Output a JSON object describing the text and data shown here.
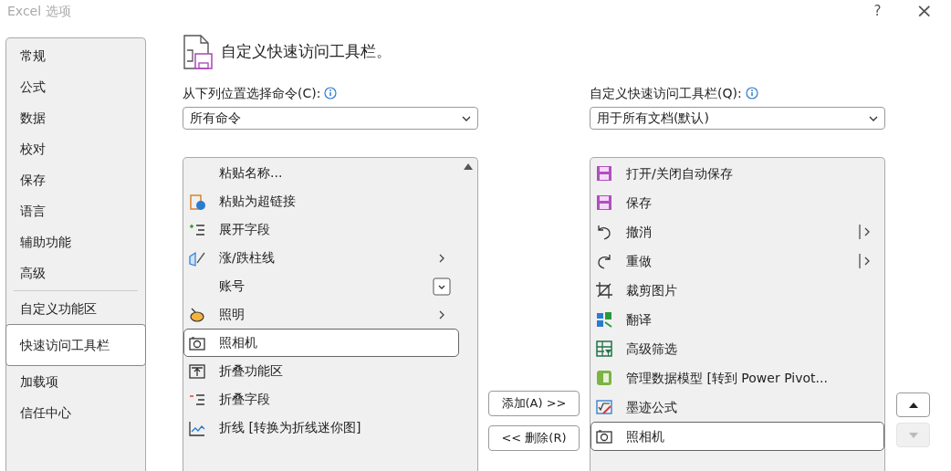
{
  "window": {
    "title": "Excel 选项",
    "help": "?",
    "close": "×"
  },
  "sidebar": {
    "items": [
      {
        "label": "常规",
        "selected": false
      },
      {
        "label": "公式",
        "selected": false
      },
      {
        "label": "数据",
        "selected": false
      },
      {
        "label": "校对",
        "selected": false
      },
      {
        "label": "保存",
        "selected": false
      },
      {
        "label": "语言",
        "selected": false
      },
      {
        "label": "辅助功能",
        "selected": false
      },
      {
        "label": "高级",
        "selected": false,
        "divider_after": true
      },
      {
        "label": "自定义功能区",
        "selected": false
      },
      {
        "label": "快速访问工具栏",
        "selected": true
      },
      {
        "label": "加载项",
        "selected": false
      },
      {
        "label": "信任中心",
        "selected": false
      }
    ]
  },
  "heading": "自定义快速访问工具栏。",
  "commands_from": {
    "label": "从下列位置选择命令(C):",
    "value": "所有命令"
  },
  "customize_for": {
    "label": "自定义快速访问工具栏(Q):",
    "value": "用于所有文档(默认)"
  },
  "available_commands": [
    {
      "label": "粘贴名称...",
      "selected": false,
      "kind": "plain"
    },
    {
      "label": "粘贴为超链接",
      "selected": false,
      "kind": "plain"
    },
    {
      "label": "展开字段",
      "selected": false,
      "kind": "plain"
    },
    {
      "label": "涨/跌柱线",
      "selected": false,
      "kind": "submenu"
    },
    {
      "label": "账号",
      "selected": false,
      "kind": "dropdown"
    },
    {
      "label": "照明",
      "selected": false,
      "kind": "submenu"
    },
    {
      "label": "照相机",
      "selected": true,
      "kind": "plain"
    },
    {
      "label": "折叠功能区",
      "selected": false,
      "kind": "plain"
    },
    {
      "label": "折叠字段",
      "selected": false,
      "kind": "plain"
    },
    {
      "label": "折线 [转换为折线迷你图]",
      "selected": false,
      "kind": "plain"
    }
  ],
  "add_button": "添加(A) >>",
  "remove_button": "<< 删除(R)",
  "toolbar_commands": [
    {
      "label": "打开/关闭自动保存",
      "selected": false,
      "kind": "plain"
    },
    {
      "label": "保存",
      "selected": false,
      "kind": "plain"
    },
    {
      "label": "撤消",
      "selected": false,
      "kind": "split"
    },
    {
      "label": "重做",
      "selected": false,
      "kind": "split"
    },
    {
      "label": "裁剪图片",
      "selected": false,
      "kind": "plain"
    },
    {
      "label": "翻译",
      "selected": false,
      "kind": "plain"
    },
    {
      "label": "高级筛选",
      "selected": false,
      "kind": "plain"
    },
    {
      "label": "管理数据模型 [转到 Power Pivot...",
      "selected": false,
      "kind": "plain"
    },
    {
      "label": "墨迹公式",
      "selected": false,
      "kind": "plain"
    },
    {
      "label": "照相机",
      "selected": true,
      "kind": "plain"
    }
  ],
  "move_up": {
    "disabled": false
  },
  "move_down": {
    "disabled": true
  }
}
